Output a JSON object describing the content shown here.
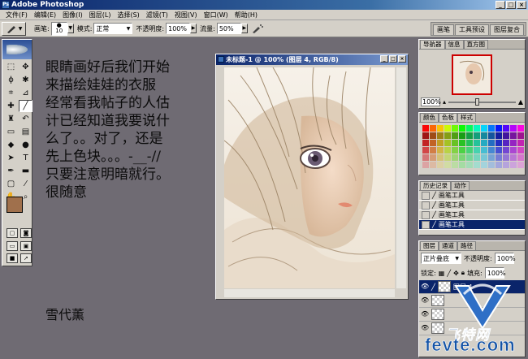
{
  "window": {
    "title": "Adobe Photoshop",
    "controls": [
      "_",
      "□",
      "×"
    ]
  },
  "menu": [
    "文件(F)",
    "编辑(E)",
    "图像(I)",
    "图层(L)",
    "选择(S)",
    "滤镜(T)",
    "视图(V)",
    "窗口(W)",
    "帮助(H)"
  ],
  "options": {
    "brush_label": "画笔:",
    "brush_size": "10",
    "mode_label": "模式:",
    "mode_value": "正常",
    "opacity_label": "不透明度:",
    "opacity_value": "100%",
    "flow_label": "流量:",
    "flow_value": "50%"
  },
  "palette_well": [
    "画笔",
    "工具预设",
    "图层复合"
  ],
  "handwritten_note": [
    "眼睛画好后我们开始",
    "来描绘娃娃的衣服",
    "经常看我帖子的人估",
    "计已经知道我要说什",
    "么了。。对了，还是",
    "先上色块。。。-__-//",
    "只要注意明暗就行。",
    "很随意"
  ],
  "signature": "雪代薰",
  "document": {
    "title": "未标题-1 @ 100% (图层 4, RGB/8)"
  },
  "navigator": {
    "tabs": [
      "导航器",
      "信息",
      "直方图"
    ],
    "zoom": "100%"
  },
  "color_panel": {
    "tabs": [
      "颜色",
      "色板",
      "样式"
    ]
  },
  "history_panel": {
    "tabs": [
      "历史记录",
      "动作"
    ],
    "items": [
      "画笔工具",
      "画笔工具",
      "画笔工具",
      "画笔工具"
    ],
    "selected_index": 3
  },
  "layers_panel": {
    "tabs": [
      "图层",
      "通道",
      "路径"
    ],
    "blend_mode": "正片叠底",
    "opacity_label": "不透明度:",
    "opacity_value": "100%",
    "lock_label": "锁定:",
    "fill_label": "填充:",
    "fill_value": "100%",
    "layer_name": "图层 4"
  },
  "watermark": {
    "cn": "飞特网",
    "domain": "fevte.com"
  },
  "colors": {
    "foreground": "#a0704c",
    "background": "#ffffff"
  }
}
